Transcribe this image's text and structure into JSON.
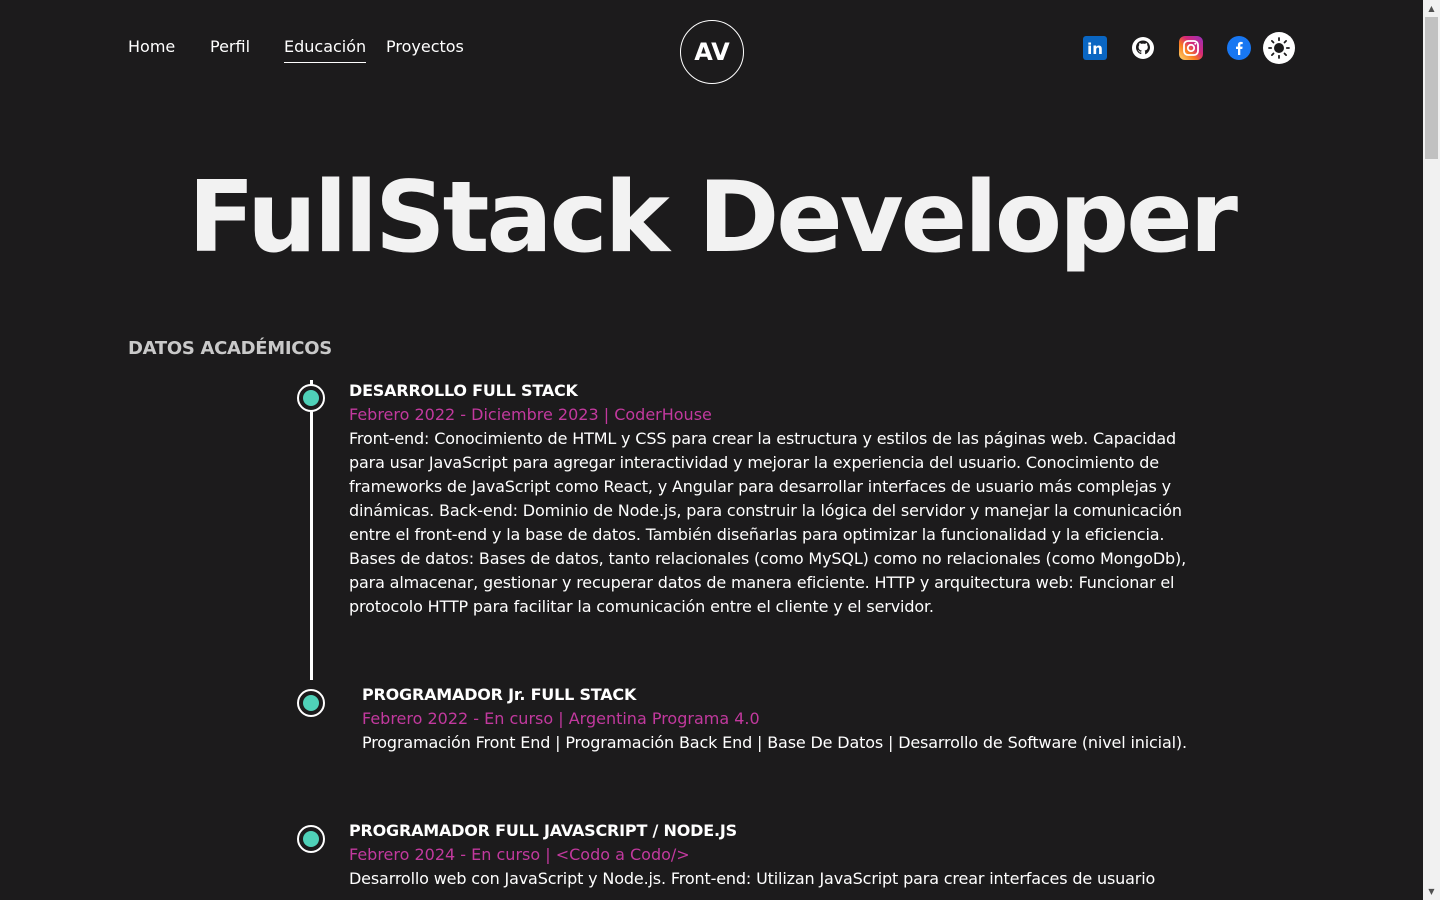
{
  "nav": {
    "home": "Home",
    "perfil": "Perfil",
    "educacion": "Educación",
    "proyectos": "Proyectos"
  },
  "logo": "AV",
  "social": {
    "icons": [
      "linkedin-icon",
      "github-icon",
      "instagram-icon",
      "facebook-icon",
      "sun-icon"
    ],
    "linkedin_label": "in"
  },
  "colors": {
    "background": "#1c1b1c",
    "accent_meta": "#c2399e",
    "timeline_dot": "#4fd1b8",
    "linkedin": "#0a66c2",
    "facebook": "#1877f2"
  },
  "hero": {
    "title": "FullStack Developer"
  },
  "section": {
    "title": "DATOS ACADÉMICOS"
  },
  "education": [
    {
      "title": "DESARROLLO FULL STACK",
      "meta": "Febrero 2022 - Diciembre 2023 | CoderHouse",
      "desc_lines": [
        "Front-end: Conocimiento de HTML y CSS para crear la estructura y estilos de las páginas web. Capacidad",
        "para usar JavaScript para agregar interactividad y mejorar la experiencia del usuario. Conocimiento de",
        "frameworks de JavaScript como React, y Angular para desarrollar interfaces de usuario más complejas y",
        "dinámicas. Back-end: Dominio de Node.js, para construir la lógica del servidor y manejar la comunicación",
        "entre el front-end y la base de datos. También diseñarlas para optimizar la funcionalidad y la eficiencia.",
        "Bases de datos: Bases de datos, tanto relacionales (como MySQL) como no relacionales (como MongoDb),",
        "para almacenar, gestionar y recuperar datos de manera eficiente. HTTP y arquitectura web: Funcionar el",
        "protocolo HTTP para facilitar la comunicación entre el cliente y el servidor."
      ]
    },
    {
      "title": "PROGRAMADOR Jr. FULL STACK",
      "meta": "Febrero 2022 - En curso | Argentina Programa 4.0",
      "desc_lines": [
        "Programación Front End | Programación Back End | Base De Datos | Desarrollo de Software (nivel inicial)."
      ]
    },
    {
      "title": "PROGRAMADOR FULL JAVASCRIPT / NODE.JS",
      "meta": "Febrero 2024 - En curso | <Codo a Codo/>",
      "desc_lines": [
        "Desarrollo web con JavaScript y Node.js. Front-end: Utilizan JavaScript para crear interfaces de usuario"
      ]
    }
  ]
}
